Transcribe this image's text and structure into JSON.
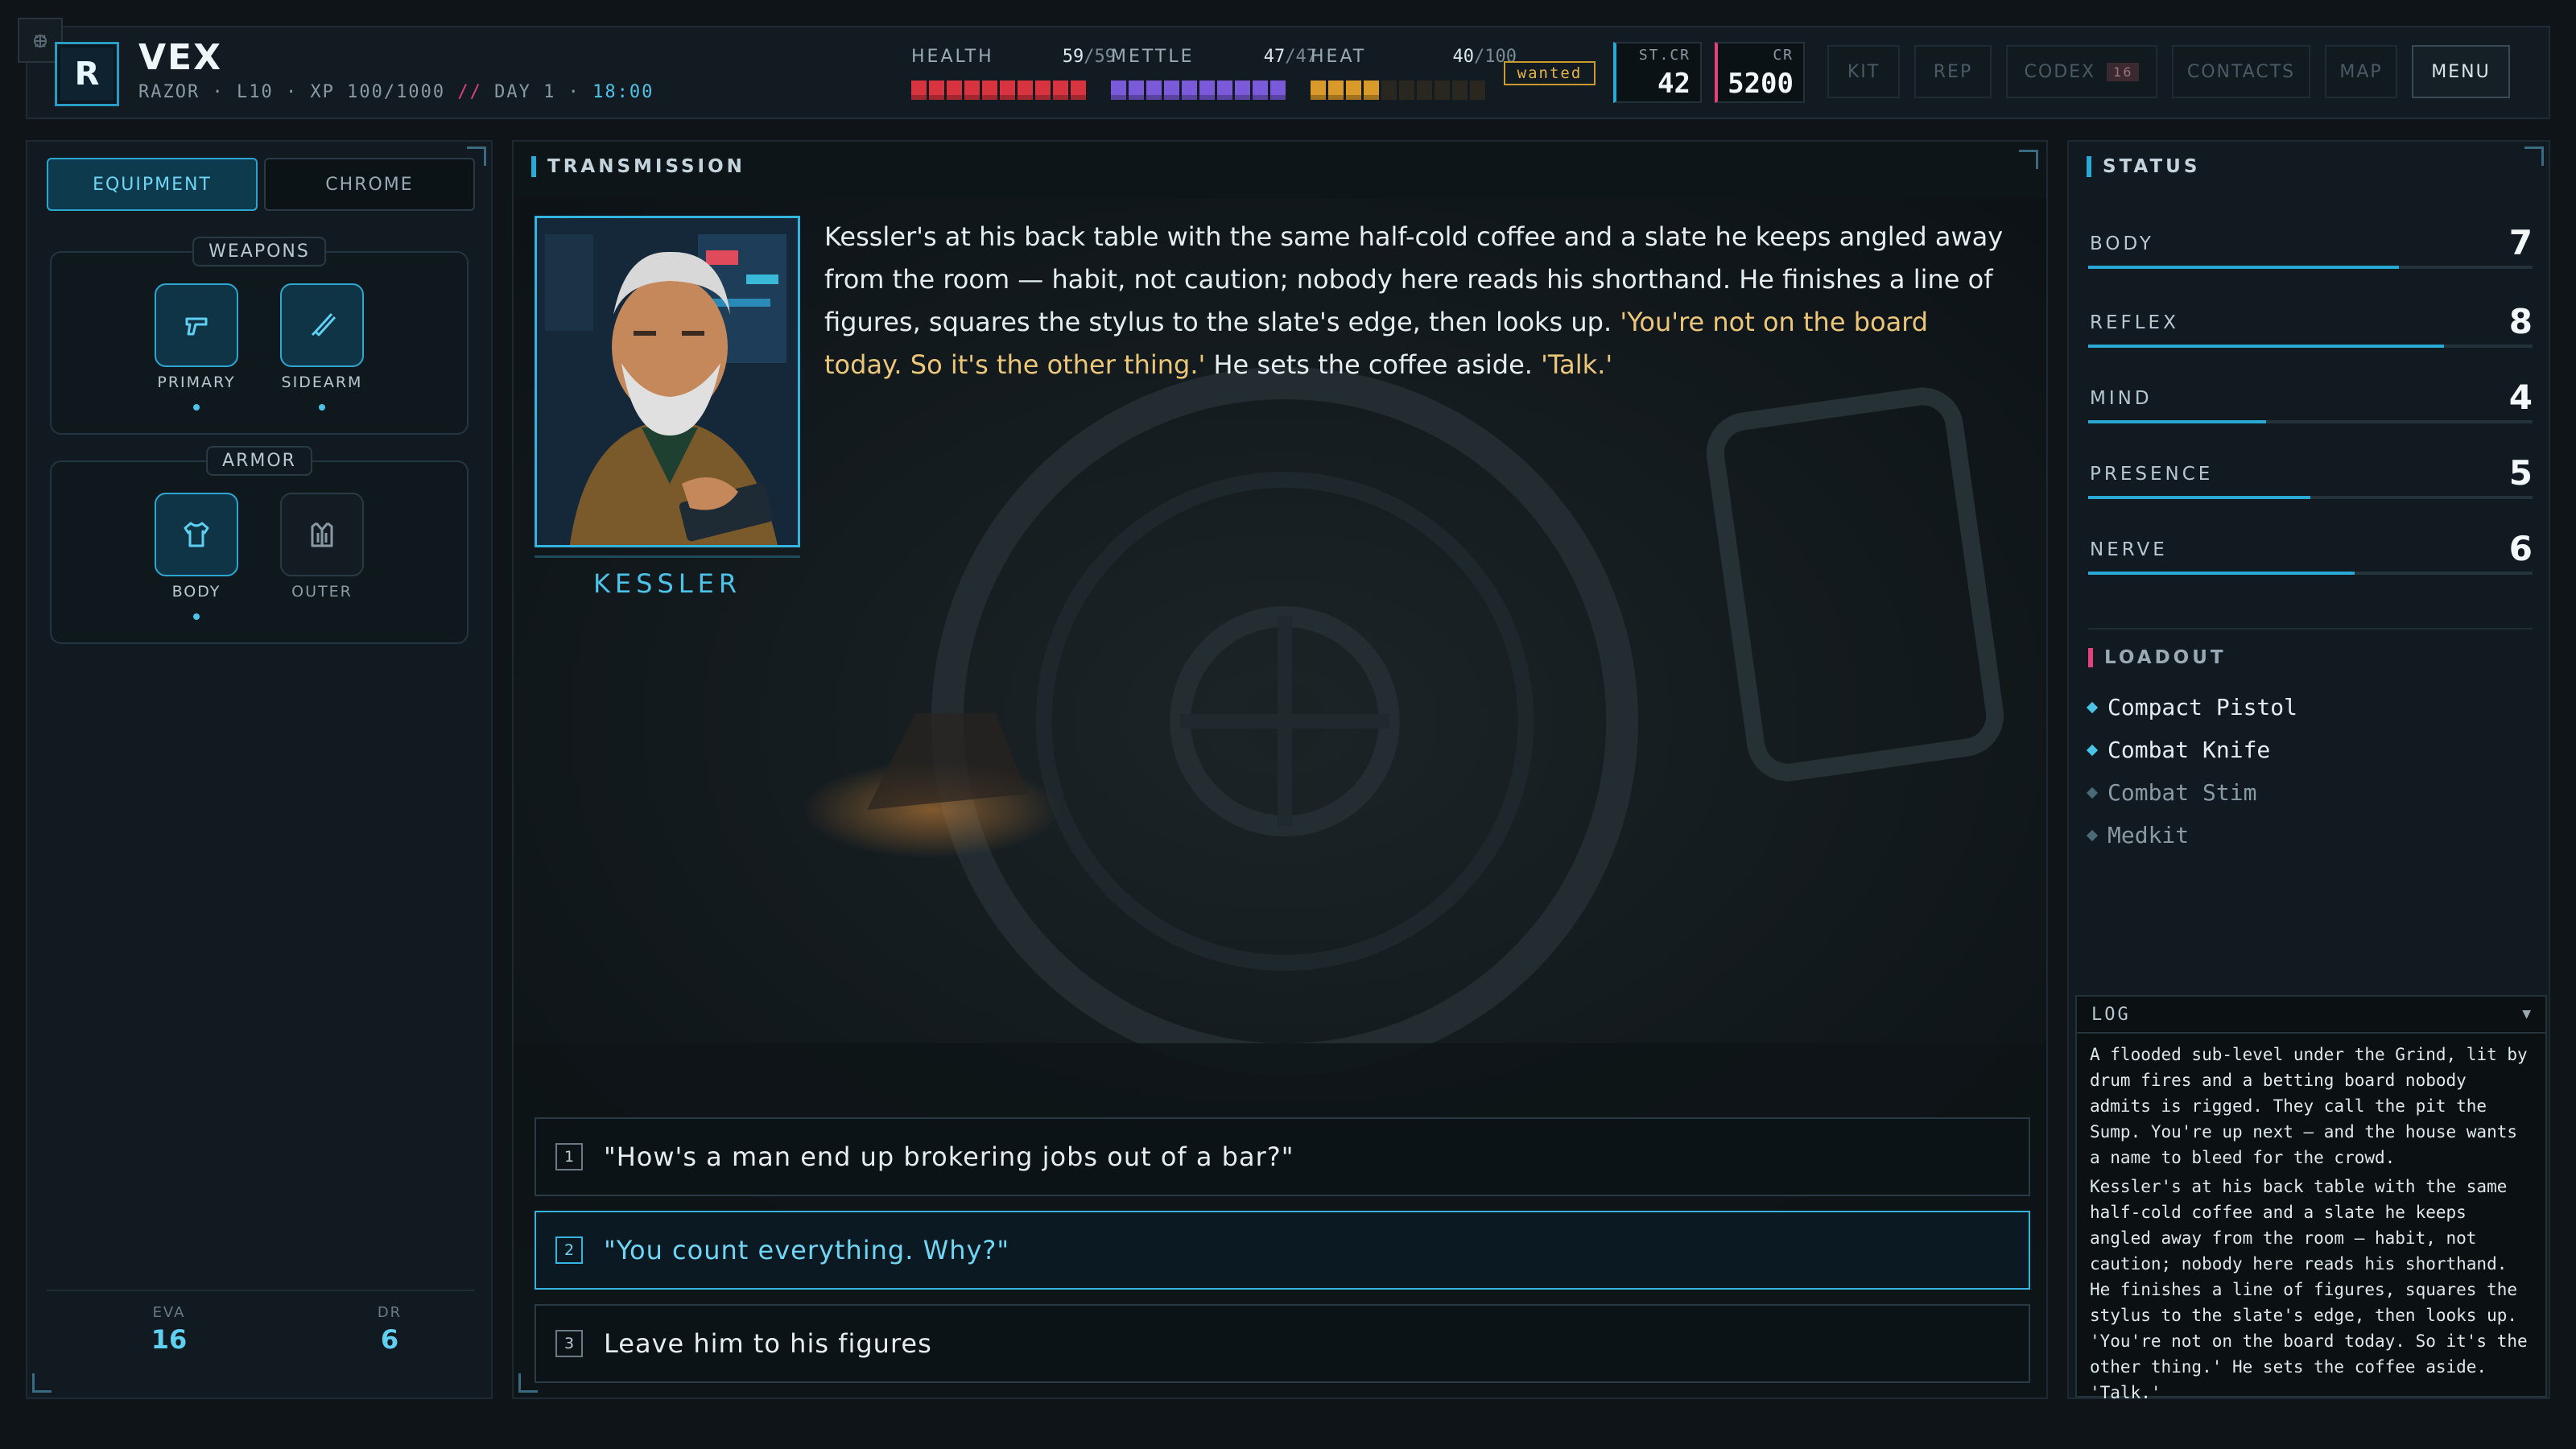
{
  "player": {
    "avatar_letter": "R",
    "name": "VEX",
    "class_level_xp": "RAZOR · L10 · XP 100/1000",
    "separator": "//",
    "day": "DAY 1 ·",
    "time": "18:00"
  },
  "stats": {
    "health": {
      "label": "HEALTH",
      "current": "59",
      "max": "/59",
      "color": "#d8343f"
    },
    "mettle": {
      "label": "METTLE",
      "current": "47",
      "max": "/47",
      "color": "#7a5ad8"
    },
    "heat": {
      "label": "HEAT",
      "current": "40",
      "max": "/100",
      "color": "#d99a2a"
    },
    "status_tag": "wanted"
  },
  "currency": {
    "street": {
      "label": "ST.CR",
      "value": "42"
    },
    "credits": {
      "label": "CR",
      "value": "5200"
    }
  },
  "nav": {
    "kit": "KIT",
    "rep": "REP",
    "codex": "CODEX",
    "codex_badge": "16",
    "contacts": "CONTACTS",
    "map": "MAP",
    "menu": "MENU"
  },
  "left": {
    "tab_equipment": "EQUIPMENT",
    "tab_chrome": "CHROME",
    "weapons_title": "WEAPONS",
    "primary": "PRIMARY",
    "sidearm": "SIDEARM",
    "armor_title": "ARMOR",
    "body": "BODY",
    "outer": "OUTER",
    "eva_label": "EVA",
    "eva_value": "16",
    "dr_label": "DR",
    "dr_value": "6"
  },
  "transmission": {
    "header": "TRANSMISSION",
    "npc_name": "KESSLER",
    "narration_1": "Kessler's at his back table with the same half-cold coffee and a slate he keeps angled away from the room — habit, not caution; nobody here reads his shorthand. He finishes a line of figures, squares the stylus to the slate's edge, then looks up. ",
    "quote_1": "'You're not on the board today. So it's the other thing.'",
    "narration_2": " He sets the coffee aside. ",
    "quote_2": "'Talk.'",
    "choices": [
      {
        "num": "1",
        "text": "\"How's a man end up brokering jobs out of a bar?\""
      },
      {
        "num": "2",
        "text": "\"You count everything. Why?\""
      },
      {
        "num": "3",
        "text": "Leave him to his figures"
      }
    ]
  },
  "status": {
    "header": "STATUS",
    "attributes": [
      {
        "label": "BODY",
        "value": "7",
        "fill": 0.7
      },
      {
        "label": "REFLEX",
        "value": "8",
        "fill": 0.8
      },
      {
        "label": "MIND",
        "value": "4",
        "fill": 0.4
      },
      {
        "label": "PRESENCE",
        "value": "5",
        "fill": 0.5
      },
      {
        "label": "NERVE",
        "value": "6",
        "fill": 0.6
      }
    ],
    "loadout_header": "LOADOUT",
    "loadout": [
      {
        "name": "Compact Pistol",
        "equipped": true
      },
      {
        "name": "Combat Knife",
        "equipped": true
      },
      {
        "name": "Combat Stim",
        "equipped": false
      },
      {
        "name": "Medkit",
        "equipped": false
      }
    ]
  },
  "log": {
    "title": "LOG",
    "entries": [
      "A flooded sub-level under the Grind, lit by drum fires and a betting board nobody admits is rigged. They call the pit the Sump. You're up next — and the house wants a name to bleed for the crowd.",
      "Kessler's at his back table with the same half-cold coffee and a slate he keeps angled away from the room — habit, not caution; nobody here reads his shorthand. He finishes a line of figures, squares the stylus to the slate's edge, then looks up. 'You're not on the board today. So it's the other thing.' He sets the coffee aside. 'Talk.'"
    ]
  }
}
